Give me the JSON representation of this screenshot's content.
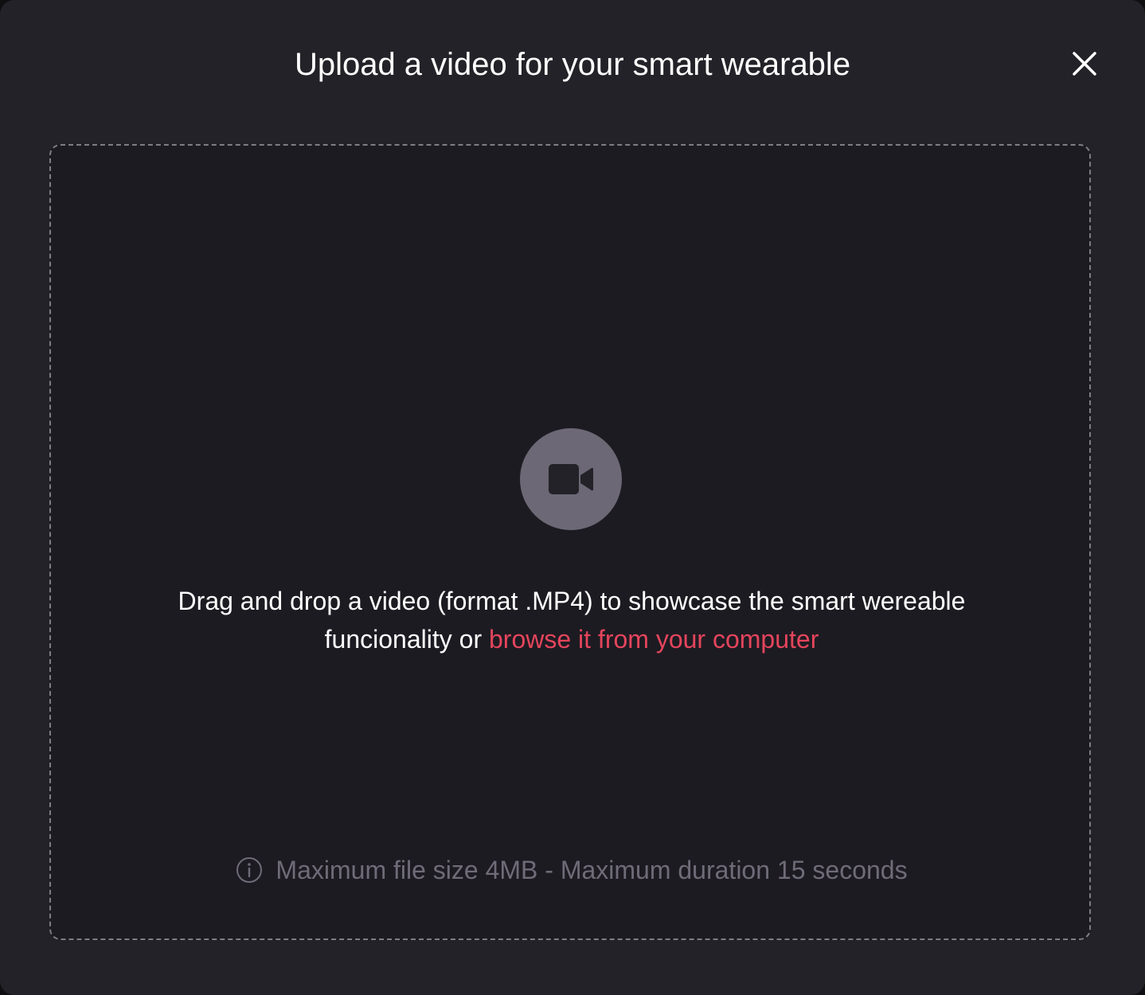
{
  "modal": {
    "title": "Upload a video for your smart wearable",
    "close_icon": "close-icon"
  },
  "dropzone": {
    "icon": "video-camera-icon",
    "instruction_text": "Drag and drop a video (format .MP4) to showcase the smart wereable funcionality or ",
    "browse_link": "browse it from your computer",
    "info_icon": "info-icon",
    "limits_text": "Maximum file size 4MB - Maximum duration 15 seconds"
  },
  "colors": {
    "modal_background": "#222228",
    "dropzone_background": "#1d1b22",
    "accent": "#e5455c",
    "muted_text": "#6f6b78",
    "icon_badge": "#6c6875"
  }
}
